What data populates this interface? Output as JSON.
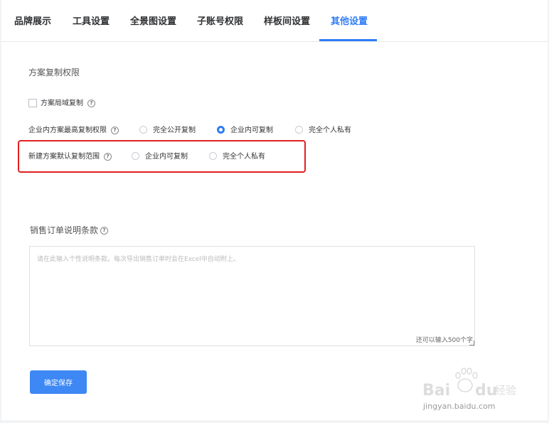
{
  "tabs": [
    {
      "label": "品牌展示"
    },
    {
      "label": "工具设置"
    },
    {
      "label": "全景图设置"
    },
    {
      "label": "子账号权限"
    },
    {
      "label": "样板间设置"
    },
    {
      "label": "其他设置"
    }
  ],
  "active_tab": "其他设置",
  "copy_permission": {
    "section_title": "方案复制权限",
    "local_copy_label": "方案局域复制",
    "max_permission": {
      "label": "企业内方案最高复制权限",
      "options": [
        "完全公开复制",
        "企业内可复制",
        "完全个人私有"
      ],
      "selected": "企业内可复制"
    },
    "default_scope": {
      "label": "新建方案默认复制范围",
      "options": [
        "企业内可复制",
        "完全个人私有"
      ],
      "selected": ""
    }
  },
  "sales_terms": {
    "label": "销售订单说明条款",
    "placeholder": "请在此输入个性说明条款。每次导出销售订单时会在Excel中自动附上。",
    "counter": "还可以输入500个字"
  },
  "save_button": "确定保存",
  "watermark": {
    "brand": "Bai du 经验",
    "url": "jingyan.baidu.com"
  },
  "colors": {
    "accent": "#2f7cf6",
    "highlight": "#e02020",
    "button": "#3d88f4"
  }
}
